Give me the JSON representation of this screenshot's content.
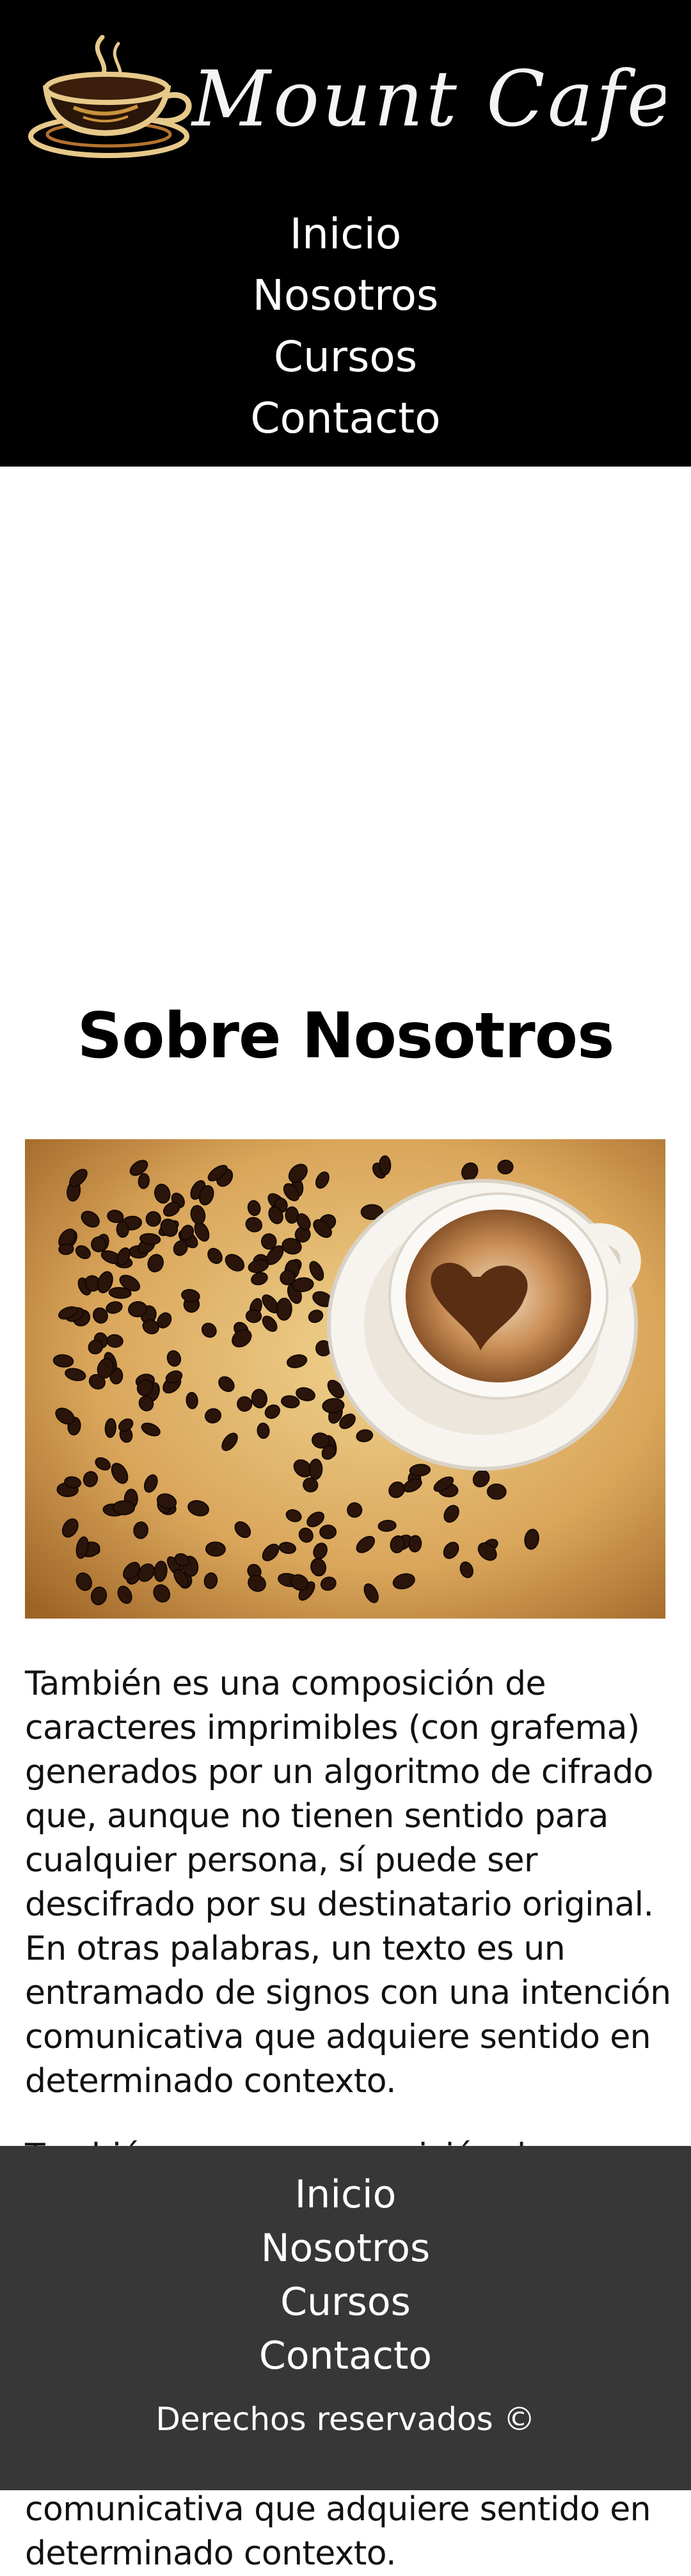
{
  "brand": {
    "logo_text": "Mount Cafe"
  },
  "header_nav": {
    "items": [
      {
        "label": "Inicio"
      },
      {
        "label": "Nosotros"
      },
      {
        "label": "Cursos"
      },
      {
        "label": "Contacto"
      }
    ]
  },
  "main": {
    "title": "Sobre Nosotros",
    "paragraphs": [
      "También es una composición de caracteres imprimibles (con grafema) generados por un algoritmo de cifrado que, aunque no tienen sentido para cualquier persona, sí puede ser descifrado por su destinatario original. En otras palabras, un texto es un entramado de signos con una intención comunicativa que adquiere sentido en determinado contexto.",
      "También es una composición de caracteres imprimibles (con grafema) generados por un algoritmo de cifrado que, aunque no tienen sentido para cualquier persona, sí puede ser descifrado por su destinatario original. En otras palabras, un texto es un entramado de signos con una intención comunicativa que adquiere sentido en determinado contexto."
    ]
  },
  "footer": {
    "nav": [
      {
        "label": "Inicio"
      },
      {
        "label": "Nosotros"
      },
      {
        "label": "Cursos"
      },
      {
        "label": "Contacto"
      }
    ],
    "copyright": "Derechos reservados ©"
  },
  "colors": {
    "header_bg": "#000000",
    "footer_bg": "#373737",
    "page_bg": "#ffffff",
    "logo_gold": "#e7c98a"
  },
  "icons": {
    "logo": "coffee-cup-icon"
  }
}
